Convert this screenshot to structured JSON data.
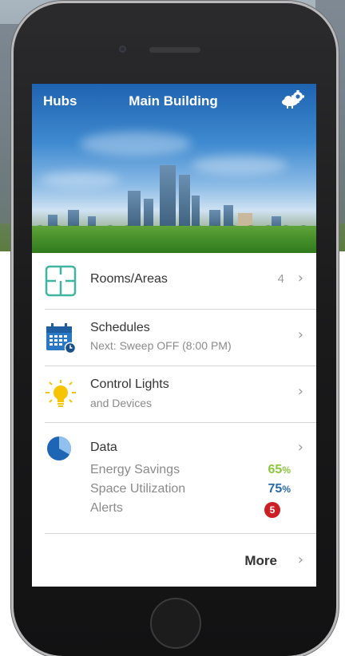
{
  "header": {
    "left_label": "Hubs",
    "title": "Main Building",
    "settings_icon": "cloud-gear-icon"
  },
  "menu": {
    "rooms": {
      "label": "Rooms/Areas",
      "count": "4",
      "icon": "floorplan-icon",
      "color": "#3fb59f"
    },
    "schedules": {
      "label": "Schedules",
      "subtitle": "Next: Sweep OFF (8:00 PM)",
      "icon": "calendar-clock-icon",
      "color": "#2a78c5"
    },
    "lights": {
      "label": "Control Lights",
      "subtitle": "and Devices",
      "icon": "lightbulb-icon",
      "color": "#f6c400"
    },
    "data": {
      "label": "Data",
      "icon": "pie-chart-icon",
      "energy_label": "Energy Savings",
      "energy_value": "65",
      "energy_unit": "%",
      "energy_color": "#8cc63f",
      "space_label": "Space Utilization",
      "space_value": "75",
      "space_unit": "%",
      "space_color": "#2a78c5",
      "alerts_label": "Alerts",
      "alerts_count": "5",
      "alerts_color": "#cc1f25"
    },
    "more_label": "More"
  },
  "chevron": "›"
}
